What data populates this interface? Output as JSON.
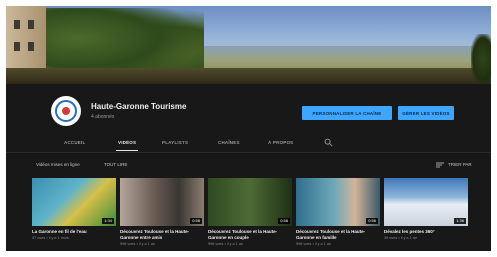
{
  "channel": {
    "name": "Haute-Garonne Tourisme",
    "subscribers": "4 abonnés",
    "primary_button": "PERSONNALISER LA CHAÎNE",
    "secondary_button": "GÉRER LES VIDÉOS"
  },
  "tabs": [
    {
      "label": "ACCUEIL",
      "active": false
    },
    {
      "label": "VIDÉOS",
      "active": true
    },
    {
      "label": "PLAYLISTS",
      "active": false
    },
    {
      "label": "CHAÎNES",
      "active": false
    },
    {
      "label": "À PROPOS",
      "active": false
    }
  ],
  "filter": {
    "label": "Vidéos mises en ligne",
    "play_all": "TOUT LIRE",
    "sort_label": "TRIER PAR"
  },
  "videos": [
    {
      "title": "La Garonne en fil de l'eau",
      "meta": "37 vues • il y a 1 mois",
      "duration": "1:34"
    },
    {
      "title": "Découvrez Toulouse et la Haute-Garonne entre amis",
      "meta": "998 vues • il y a 1 an",
      "duration": "0:58"
    },
    {
      "title": "Découvrez Toulouse et la Haute-Garonne en couple",
      "meta": "996 vues • il y a 1 an",
      "duration": "0:58"
    },
    {
      "title": "Découvrez Toulouse et la Haute-Garonne en famille",
      "meta": "998 vues • il y a 1 an",
      "duration": "0:56"
    },
    {
      "title": "Dévalez les pentes 360°",
      "meta": "39 vues • il y a 1 an",
      "duration": "1:36"
    }
  ],
  "colors": {
    "accent_button": "#3ea6ff",
    "background": "#181818",
    "text_primary": "#f0f0f0",
    "text_secondary": "#9a9a9a"
  },
  "icons": {
    "search": "search-icon",
    "sort": "sort-icon",
    "avatar_logo": "channel-logo"
  }
}
